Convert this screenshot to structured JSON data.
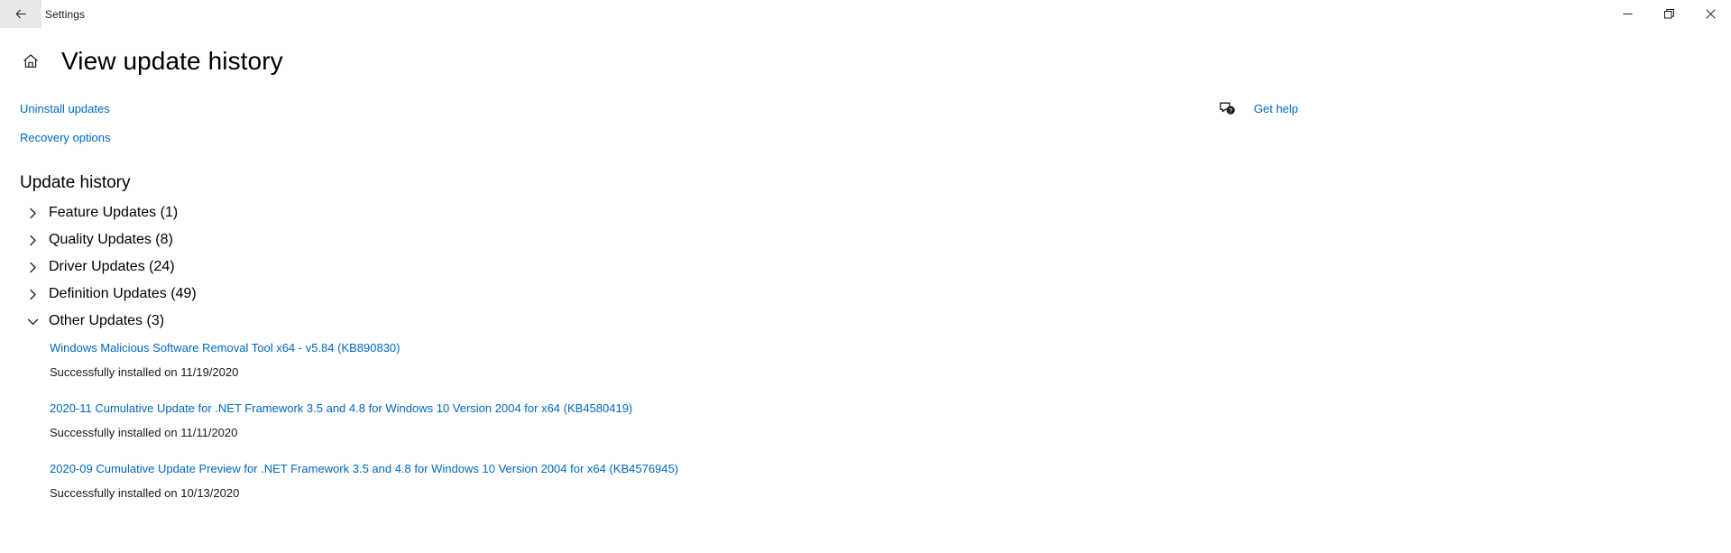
{
  "titlebar": {
    "back_label": "back-arrow",
    "app_title": "Settings",
    "minimize_label": "Minimize",
    "restore_label": "Restore",
    "close_label": "Close"
  },
  "header": {
    "home_icon": "home-icon",
    "page_title": "View update history"
  },
  "actions": {
    "uninstall_updates": "Uninstall updates",
    "recovery_options": "Recovery options",
    "get_help": "Get help",
    "get_help_icon": "help-bubble-icon"
  },
  "update_history": {
    "section_title": "Update history",
    "categories": [
      {
        "label": "Feature Updates (1)",
        "expanded": false,
        "chevron": "chevron-right-icon"
      },
      {
        "label": "Quality Updates (8)",
        "expanded": false,
        "chevron": "chevron-right-icon"
      },
      {
        "label": "Driver Updates (24)",
        "expanded": false,
        "chevron": "chevron-right-icon"
      },
      {
        "label": "Definition Updates (49)",
        "expanded": false,
        "chevron": "chevron-right-icon"
      },
      {
        "label": "Other Updates (3)",
        "expanded": true,
        "chevron": "chevron-down-icon"
      }
    ],
    "other_updates_items": [
      {
        "title": "Windows Malicious Software Removal Tool x64 - v5.84 (KB890830)",
        "status": "Successfully installed on 11/19/2020"
      },
      {
        "title": "2020-11 Cumulative Update for .NET Framework 3.5 and 4.8 for Windows 10 Version 2004 for x64 (KB4580419)",
        "status": "Successfully installed on 11/11/2020"
      },
      {
        "title": "2020-09 Cumulative Update Preview for .NET Framework 3.5 and 4.8 for Windows 10 Version 2004 for x64 (KB4576945)",
        "status": "Successfully installed on 10/13/2020"
      }
    ]
  },
  "colors": {
    "link": "#0067c0",
    "background": "#ffffff",
    "text": "#000000"
  }
}
